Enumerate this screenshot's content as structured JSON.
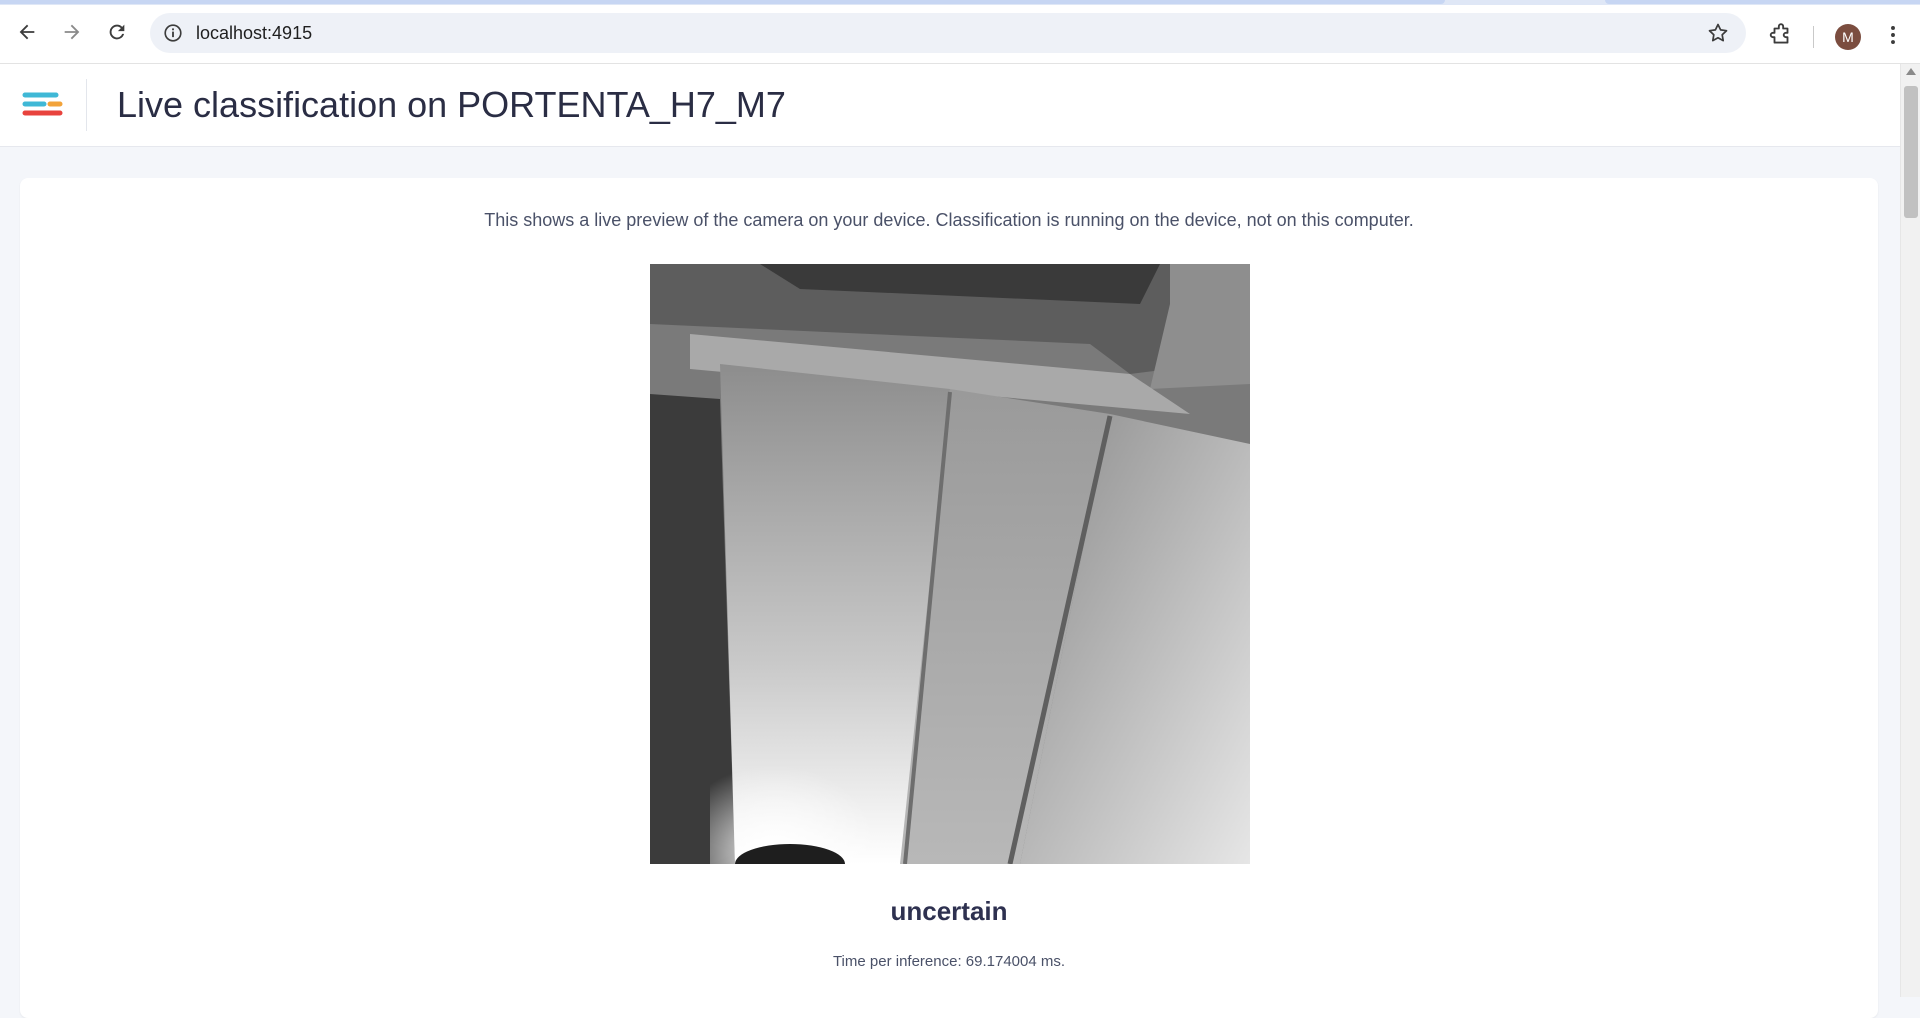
{
  "browser": {
    "url": "localhost:4915",
    "profile_initial": "M",
    "icons": [
      "back-icon",
      "forward-icon",
      "reload-icon",
      "info-icon",
      "star-icon",
      "extensions-icon",
      "menu-icon"
    ]
  },
  "header": {
    "title": "Live classification on PORTENTA_H7_M7",
    "logo_colors": [
      "#3fb8d6",
      "#f2a33a",
      "#e8433d"
    ]
  },
  "main": {
    "intro": "This shows a live preview of the camera on your device. Classification is running on the device, not on this computer.",
    "classification": "uncertain",
    "timing": "Time per inference: 69.174004 ms."
  }
}
